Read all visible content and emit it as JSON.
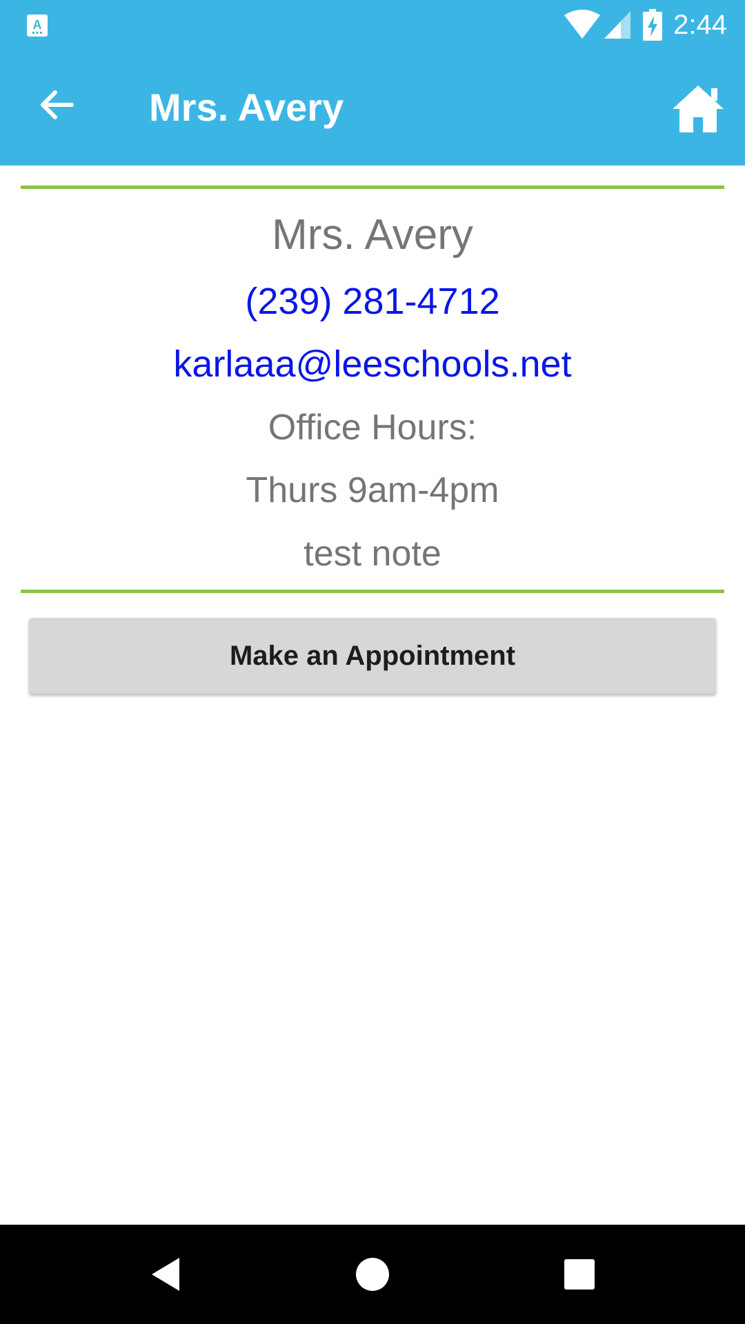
{
  "status_bar": {
    "time": "2:44",
    "icons": [
      "app-notification-icon",
      "wifi-icon",
      "cell-signal-icon",
      "battery-charging-icon"
    ]
  },
  "toolbar": {
    "title": "Mrs. Avery",
    "back_icon": "arrow-left-icon",
    "home_icon": "home-icon"
  },
  "contact": {
    "name": "Mrs. Avery",
    "phone": "(239) 281-4712",
    "email": "karlaaa@leeschools.net",
    "office_hours_label": "Office Hours:",
    "office_hours": "Thurs 9am-4pm",
    "note": "test note"
  },
  "actions": {
    "appointment_label": "Make an Appointment"
  },
  "nav_bar": {
    "icons": [
      "nav-back-icon",
      "nav-home-icon",
      "nav-recents-icon"
    ]
  },
  "colors": {
    "toolbar": "#3bb6e4",
    "divider": "#8bc34a",
    "link": "#0a16e6",
    "text": "#757575",
    "button": "#d6d7d7"
  }
}
